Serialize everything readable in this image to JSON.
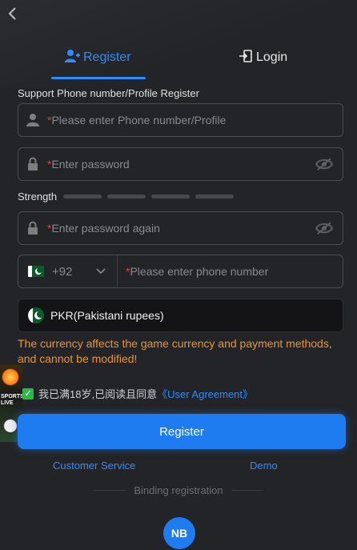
{
  "tabs": {
    "register": "Register",
    "login": "Login"
  },
  "section_label": "Support Phone number/Profile Register",
  "fields": {
    "phone_profile": {
      "star": "*",
      "placeholder": "Please enter Phone number/Profile"
    },
    "password": {
      "star": "*",
      "placeholder": "Enter password"
    },
    "password_again": {
      "star": "*",
      "placeholder": "Enter password again"
    },
    "phone": {
      "country_code": "+92",
      "star": "*",
      "placeholder": "Please enter phone number"
    },
    "currency": {
      "value": "PKR(Pakistani rupees)"
    }
  },
  "strength": {
    "label": "Strength",
    "bars": 4
  },
  "notice": "The currency affects the game currency and payment methods, and cannot be modified!",
  "agreement": {
    "text": "我已满18岁,已阅读且同意",
    "link": "《User Agreement》"
  },
  "register_button": "Register",
  "links": {
    "customer_service": "Customer Service",
    "demo": "Demo"
  },
  "binding": "Binding registration",
  "promo": {
    "text": "SPORTS LIVE"
  },
  "logo": {
    "text": "NB"
  },
  "colors": {
    "accent": "#2f8cff",
    "warning": "#e8963a",
    "required": "#e0423a",
    "check": "#2fb84a"
  }
}
